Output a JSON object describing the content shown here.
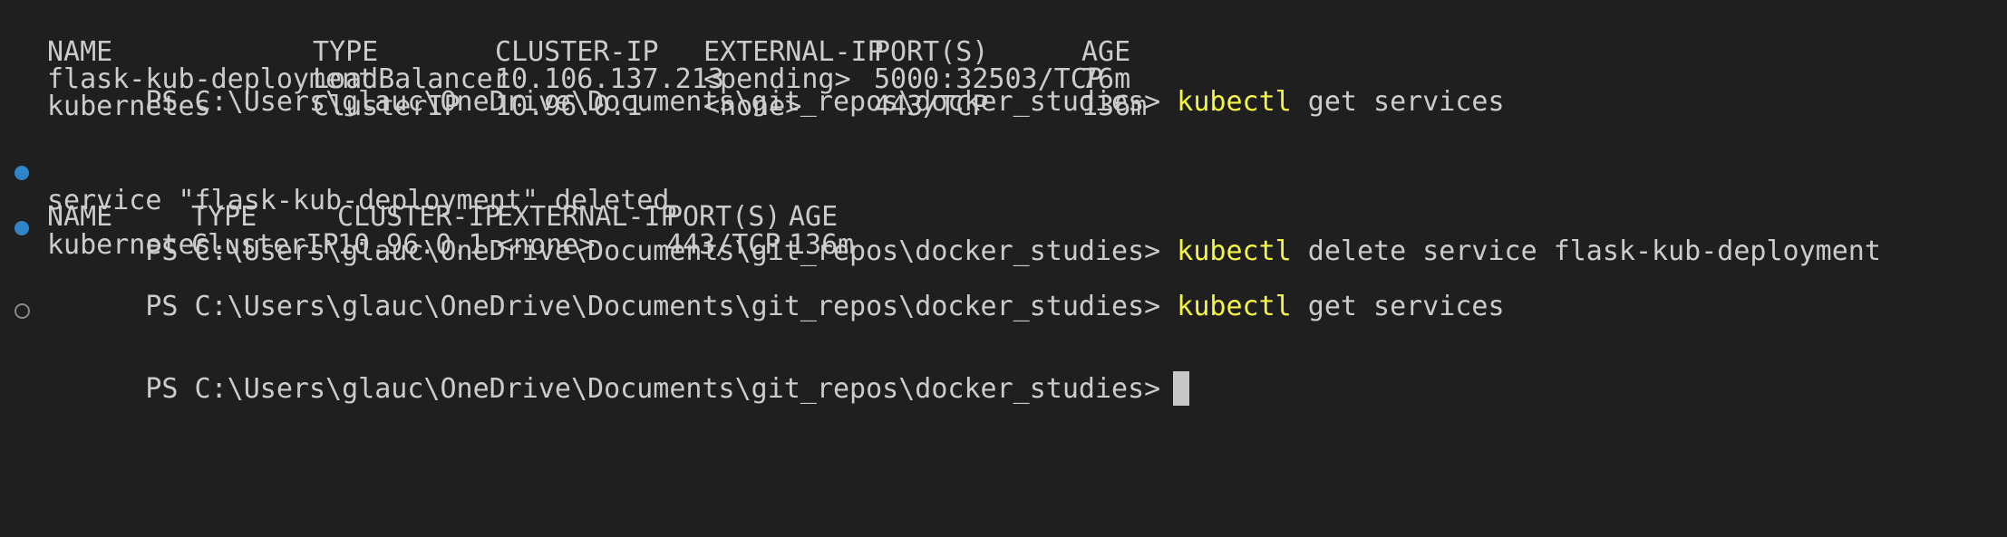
{
  "terminal": {
    "prompt": "PS C:\\Users\\glauc\\OneDrive\\Documents\\git_repos\\docker_studies>",
    "command_word": "kubectl",
    "cmd1_args": " get services",
    "table1": {
      "headers": [
        "NAME",
        "TYPE",
        "CLUSTER-IP",
        "EXTERNAL-IP",
        "PORT(S)",
        "AGE"
      ],
      "rows": [
        [
          "flask-kub-deployment",
          "LoadBalancer",
          "10.106.137.213",
          "<pending>",
          "5000:32503/TCP",
          "76m"
        ],
        [
          "kubernetes",
          "ClusterIP",
          "10.96.0.1",
          "<none>",
          "443/TCP",
          "136m"
        ]
      ]
    },
    "cmd2_args": " delete service flask-kub-deployment",
    "delete_output": "service \"flask-kub-deployment\" deleted",
    "cmd3_args": " get services",
    "table2": {
      "headers": [
        "NAME",
        "TYPE",
        "CLUSTER-IP",
        "EXTERNAL-IP",
        "PORT(S)",
        "AGE"
      ],
      "rows": [
        [
          "kubernetes",
          "ClusterIP",
          "10.96.0.1",
          "<none>",
          "443/TCP",
          "136m"
        ]
      ]
    },
    "colors": {
      "background": "#1f1f1f",
      "text": "#cccccc",
      "command": "#f5f543",
      "success_dot": "#2f84c8",
      "pending_dot": "#8a8a8a"
    }
  }
}
